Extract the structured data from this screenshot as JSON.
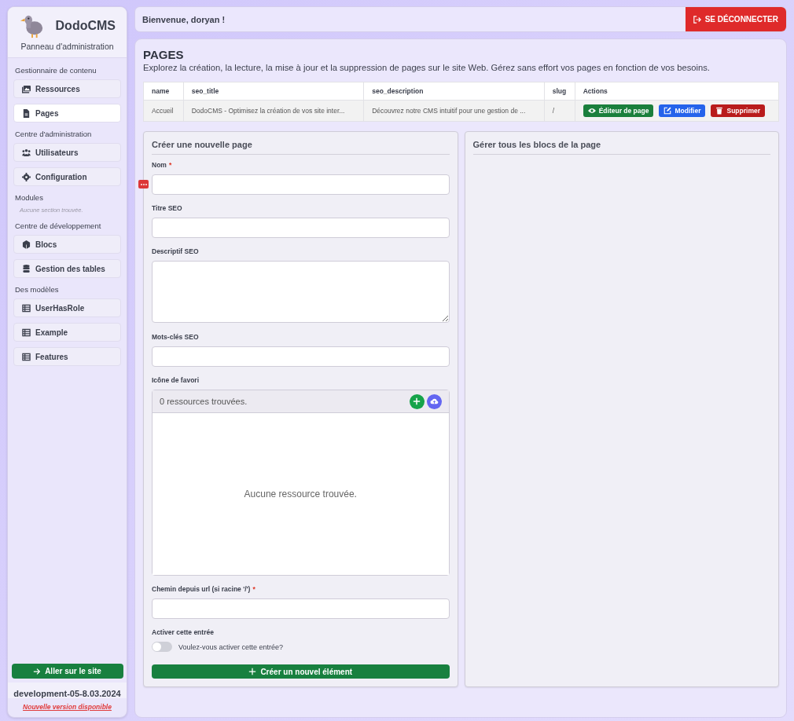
{
  "sidebar": {
    "brand": "DodoCMS",
    "subtitle": "Panneau d'administration",
    "sections": [
      {
        "title": "Gestionnaire de contenu",
        "items": [
          {
            "label": "Ressources",
            "selected": false
          },
          {
            "label": "Pages",
            "selected": true
          }
        ]
      },
      {
        "title": "Centre d'administration",
        "items": [
          {
            "label": "Utilisateurs",
            "selected": false
          },
          {
            "label": "Configuration",
            "selected": false
          }
        ]
      },
      {
        "title": "Modules",
        "empty": "Aucune section trouvée."
      },
      {
        "title": "Centre de développement",
        "items": [
          {
            "label": "Blocs",
            "selected": false
          },
          {
            "label": "Gestion des tables",
            "selected": false
          }
        ]
      },
      {
        "title": "Des modèles",
        "items": [
          {
            "label": "UserHasRole",
            "selected": false
          },
          {
            "label": "Example",
            "selected": false
          },
          {
            "label": "Features",
            "selected": false
          }
        ]
      }
    ],
    "site_button": "Aller sur le site",
    "version": "development-05-8.03.2024",
    "update_link": "Nouvelle version disponible"
  },
  "topbar": {
    "welcome": "Bienvenue, doryan !",
    "logout": "SE DÉCONNECTER"
  },
  "page": {
    "title": "PAGES",
    "description": "Explorez la création, la lecture, la mise à jour et la suppression de pages sur le site Web. Gérez sans effort vos pages en fonction de vos besoins.",
    "table": {
      "columns": [
        "name",
        "seo_title",
        "seo_description",
        "slug",
        "Actions"
      ],
      "rows": [
        {
          "cells": [
            "Accueil",
            "DodoCMS - Optimisez la création de vos site inter...",
            "Découvrez notre CMS intuitif pour une gestion de ...",
            "/"
          ],
          "actions": [
            {
              "label": "Éditeur de page",
              "kind": "view"
            },
            {
              "label": "Modifier",
              "kind": "edit"
            },
            {
              "label": "Supprimer",
              "kind": "delete"
            }
          ]
        }
      ]
    },
    "form": {
      "title": "Créer une nouvelle page",
      "fields": [
        {
          "kind": "text",
          "label": "Nom",
          "mark": "*"
        },
        {
          "kind": "text",
          "label": "Titre SEO"
        },
        {
          "kind": "textarea",
          "label": "Descriptif SEO"
        },
        {
          "kind": "text",
          "label": "Mots-clés SEO"
        },
        {
          "kind": "resources",
          "label": "Icône de favori",
          "count": "0 ressources trouvées.",
          "empty": "Aucune ressource trouvée."
        },
        {
          "kind": "text",
          "label": "Chemin depuis url (si racine '/')",
          "mark": "*"
        },
        {
          "kind": "toggle",
          "label": "Activer cette entrée",
          "text": "Voulez-vous activer cette entrée?",
          "on": false
        }
      ],
      "submit": "Créer un nouvel élément"
    },
    "blocks_panel": {
      "title": "Gérer tous les blocs de la page"
    }
  }
}
